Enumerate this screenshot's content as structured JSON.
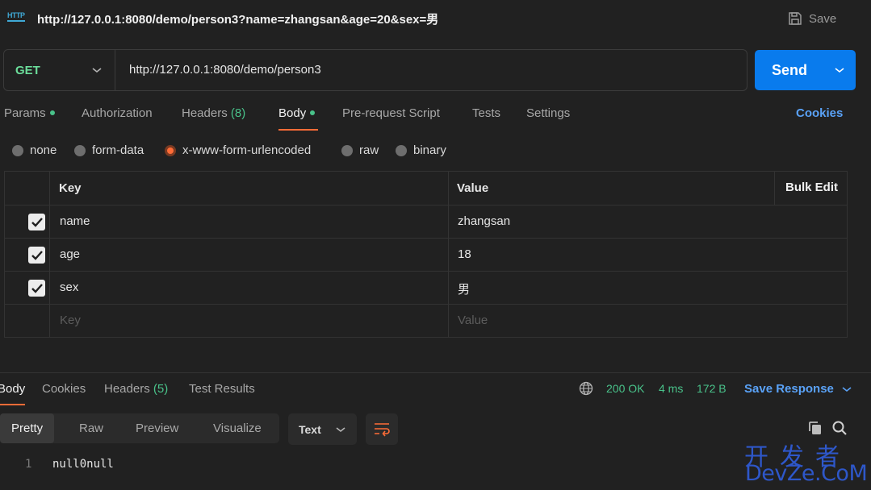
{
  "header": {
    "badge": "HTTP",
    "title": "http://127.0.0.1:8080/demo/person3?name=zhangsan&age=20&sex=男",
    "save_label": "Save"
  },
  "request": {
    "method": "GET",
    "url": "http://127.0.0.1:8080/demo/person3",
    "send_label": "Send"
  },
  "req_tabs": {
    "params": "Params",
    "authorization": "Authorization",
    "headers": "Headers",
    "headers_count": "(8)",
    "body": "Body",
    "prerequest": "Pre-request Script",
    "tests": "Tests",
    "settings": "Settings",
    "cookies": "Cookies"
  },
  "body_types": {
    "none": "none",
    "form_data": "form-data",
    "urlencoded": "x-www-form-urlencoded",
    "raw": "raw",
    "binary": "binary",
    "selected": "x-www-form-urlencoded"
  },
  "kv_table": {
    "key_header": "Key",
    "value_header": "Value",
    "bulk_edit": "Bulk Edit",
    "rows": [
      {
        "key": "name",
        "value": "zhangsan",
        "checked": true
      },
      {
        "key": "age",
        "value": "18",
        "checked": true
      },
      {
        "key": "sex",
        "value": "男",
        "checked": true
      }
    ],
    "key_placeholder": "Key",
    "value_placeholder": "Value"
  },
  "response": {
    "tabs": {
      "body": "Body",
      "cookies": "Cookies",
      "headers": "Headers",
      "headers_count": "(5)",
      "test_results": "Test Results"
    },
    "status": "200 OK",
    "time": "4 ms",
    "size": "172 B",
    "save_response": "Save Response",
    "view_modes": {
      "pretty": "Pretty",
      "raw": "Raw",
      "preview": "Preview",
      "visualize": "Visualize"
    },
    "format": "Text",
    "code_lines": [
      {
        "no": "1",
        "text": "null0null"
      }
    ]
  },
  "watermark": {
    "top": "开发者",
    "bottom": "DevZe.CoM"
  },
  "colors": {
    "accent": "#ff6c37",
    "send_blue": "#097bed",
    "link_blue": "#5aa2f7",
    "success_green": "#49c28a",
    "method_green": "#6bdd9a"
  },
  "icons": [
    "http-icon",
    "save-icon",
    "chevron-down-icon",
    "globe-icon",
    "wrap-lines-icon",
    "copy-icon",
    "search-icon"
  ]
}
